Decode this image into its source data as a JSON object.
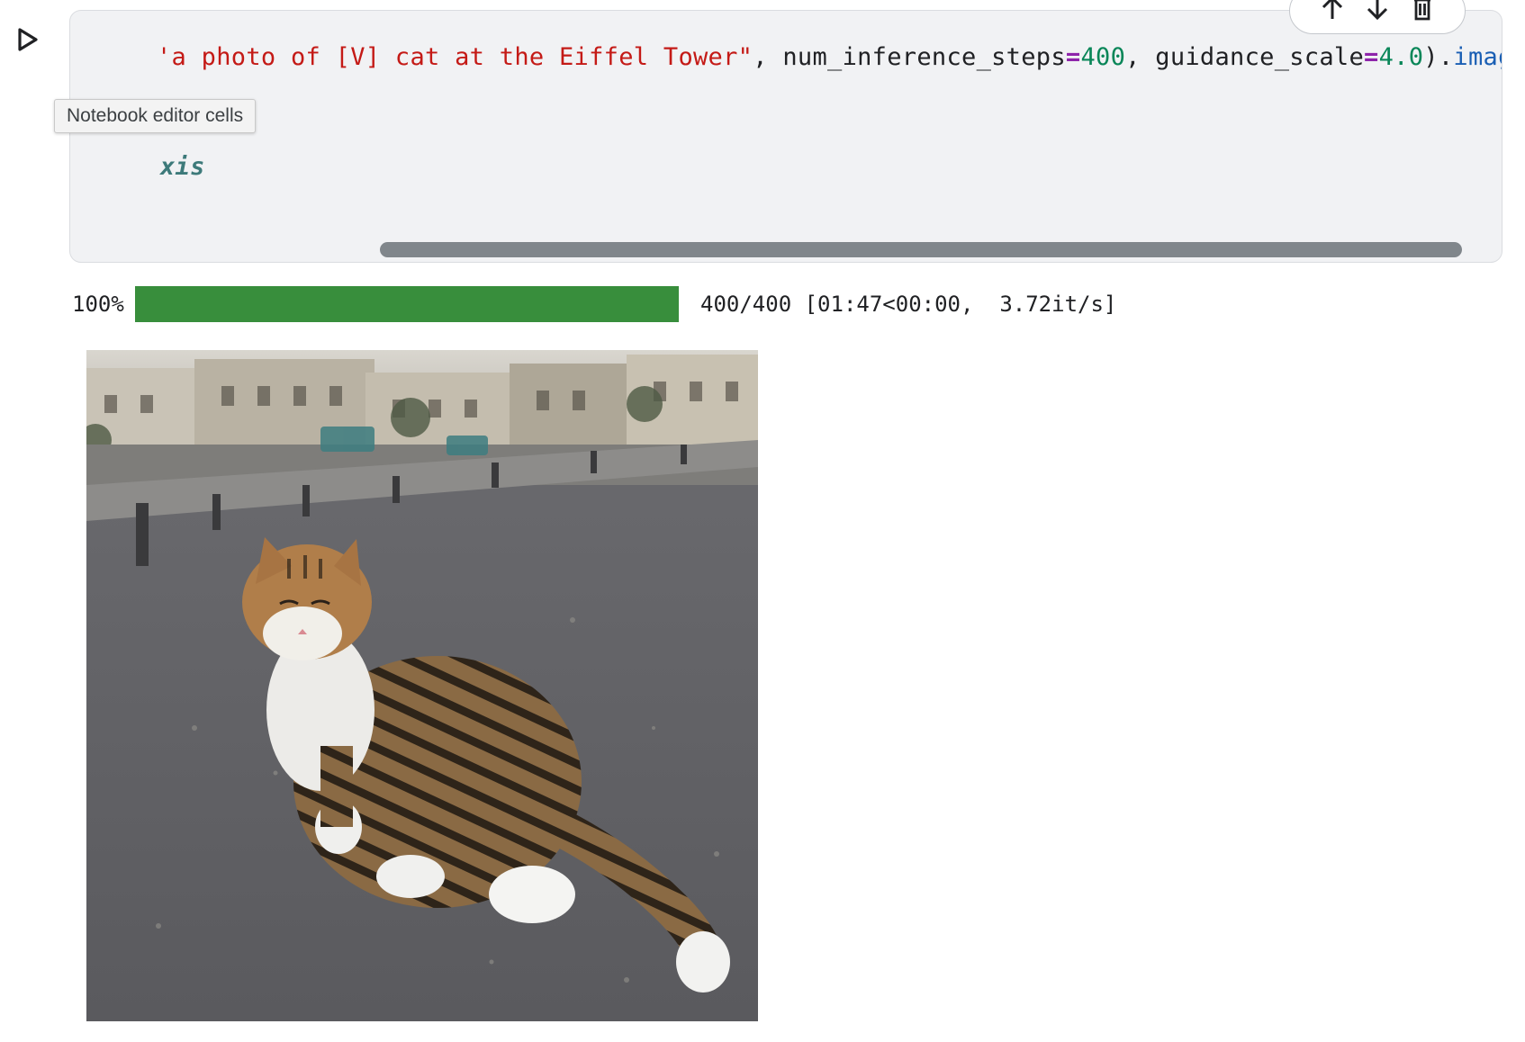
{
  "cell": {
    "code_line_1": {
      "string": "'a photo of [V] cat at the Eiffel Tower\"",
      "sep1": ", ",
      "param1_name": "num_inference_steps",
      "eq": "=",
      "param1_value": "400",
      "sep2": ", ",
      "param2_name": "guidance_scale",
      "param2_value": "4.0",
      "close_paren": ").",
      "attr_name": "images",
      "bracket": "["
    },
    "code_line_3": {
      "partial_glyph": "(",
      "keyword": "xis"
    },
    "tooltip": "Notebook editor cells",
    "toolbar": {
      "move_up_icon": "arrow-up-icon",
      "move_down_icon": "arrow-down-icon",
      "delete_icon": "trash-icon"
    },
    "run_icon": "play-icon"
  },
  "output": {
    "progress": {
      "percent_label": "100%",
      "fraction": 1.0,
      "stats": "400/400 [01:47<00:00,  3.72it/s]",
      "bar_color": "#388e3c"
    },
    "image": {
      "subject": "tabby-cat-on-pavement-photo"
    }
  },
  "colors": {
    "cell_background": "#f1f2f4",
    "string": "#c41a16",
    "number": "#098658",
    "operator": "#8e24aa",
    "attribute": "#1a5fb4"
  }
}
